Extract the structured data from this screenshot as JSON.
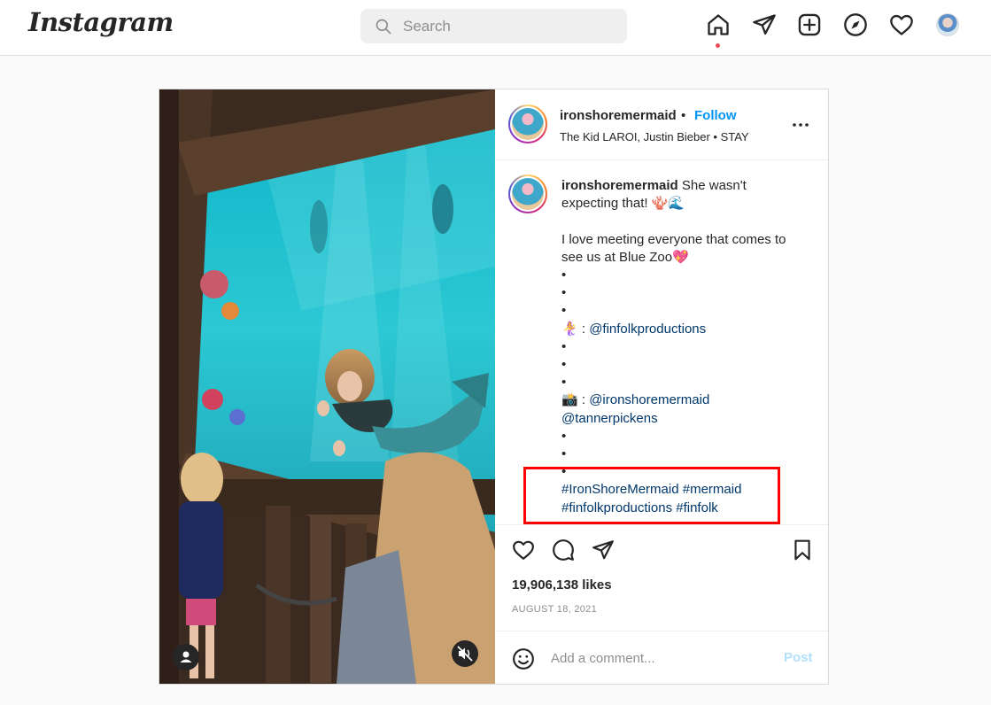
{
  "app": {
    "logo_text": "Instagram"
  },
  "nav": {
    "search_placeholder": "Search",
    "icons": [
      "home-icon",
      "direct-send-icon",
      "new-post-icon",
      "explore-compass-icon",
      "activity-heart-icon",
      "profile-avatar"
    ],
    "notification_dot_color": "#ed4956"
  },
  "post": {
    "header": {
      "username": "ironshoremermaid",
      "bullet": "•",
      "follow_label": "Follow",
      "audio": "The Kid LAROI, Justin Bieber • STAY"
    },
    "caption": {
      "username": "ironshoremermaid",
      "lines": [
        "She wasn't",
        "expecting that! 🪸🌊",
        "",
        "I love meeting everyone that comes to",
        "see us at Blue Zoo💖",
        "•",
        "•",
        "•"
      ],
      "credit1_prefix": "🧜‍♀️ : ",
      "credit1_mention": "@finfolkproductions",
      "dots2": [
        "•",
        "•",
        "•"
      ],
      "credit2_prefix": "📸 : ",
      "credit2_mention1": "@ironshoremermaid",
      "credit2_mention2": "@tannerpickens",
      "dots3": [
        "•",
        "•",
        "•"
      ],
      "hashtags_line1": [
        "#IronShoreMermaid",
        "#mermaid"
      ],
      "hashtags_line2": [
        "#finfolkproductions",
        "#finfolk"
      ]
    },
    "likes": "19,906,138 likes",
    "date": "AUGUST 18, 2021",
    "comment_placeholder": "Add a comment...",
    "post_label": "Post",
    "colors": {
      "follow": "#0095f6",
      "link": "#00376b",
      "post_disabled": "#b2dffc",
      "highlight": "#ff0000"
    }
  }
}
